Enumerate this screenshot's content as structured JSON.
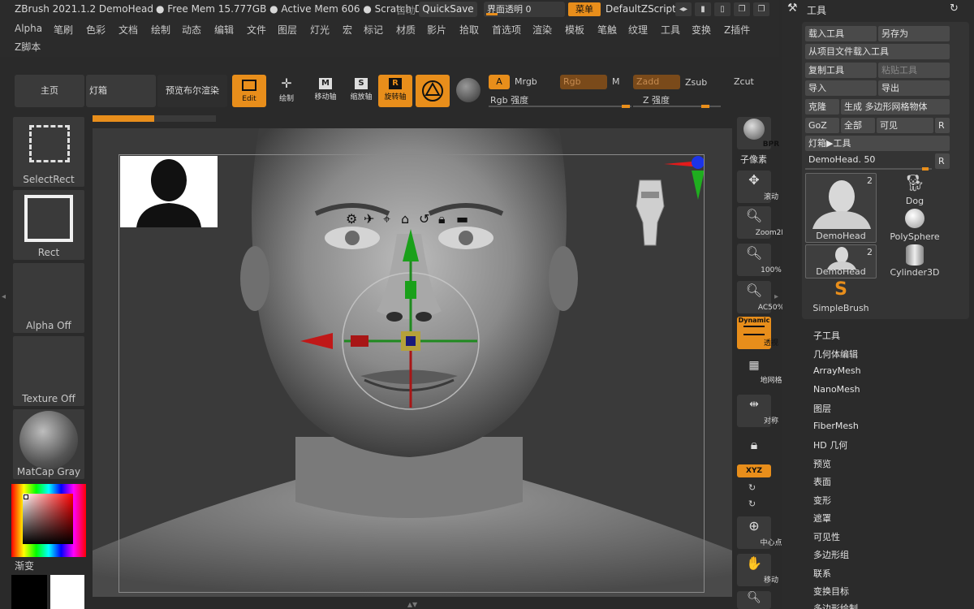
{
  "title_bar": {
    "app_info": "ZBrush 2021.1.2 DemoHead",
    "mem_info": "● Free Mem 15.777GB ● Active Mem 606 ● Scratch D",
    "auto_label": "自动",
    "quicksave": "QuickSave",
    "ui_transparency": "界面透明 0",
    "menu_button": "菜单",
    "default_zscript": "DefaultZScript"
  },
  "menu": {
    "row1": [
      "Alpha",
      "笔刷",
      "色彩",
      "文档",
      "绘制",
      "动态",
      "编辑",
      "文件",
      "图层",
      "灯光",
      "宏",
      "标记",
      "材质",
      "影片",
      "拾取",
      "首选项",
      "渲染",
      "模板",
      "笔触",
      "纹理",
      "工具",
      "变换",
      "Z插件"
    ],
    "row2": [
      "Z脚本"
    ]
  },
  "toolbar": {
    "home": "主页",
    "lightbox": "灯箱",
    "bpr_preview": "预览布尔渲染",
    "edit": "Edit",
    "draw": "绘制",
    "move": "移动轴",
    "scale": "缩放轴",
    "rotate": "旋转轴",
    "mode_a": "A",
    "mrgb": "Mrgb",
    "rgb": "Rgb",
    "m": "M",
    "zadd": "Zadd",
    "zsub": "Zsub",
    "zcut": "Zcut",
    "rgb_intensity": "Rgb 强度",
    "z_intensity": "Z 强度"
  },
  "left_shelf": {
    "select_rect": "SelectRect",
    "rect": "Rect",
    "alpha_off": "Alpha Off",
    "texture_off": "Texture Off",
    "matcap": "MatCap Gray",
    "gradient": "渐变"
  },
  "right_shelf": {
    "bpr": "BPR",
    "subpixel": "子像素",
    "scroll": "滚动",
    "zoom2d": "Zoom2D",
    "pct100": "100%",
    "ac50": "AC50%",
    "dynamic": "Dynamic",
    "perspective": "透视",
    "floor": "地网格",
    "symmetry": "对称",
    "xyz": "XYZ",
    "center": "中心点",
    "move": "移动"
  },
  "tool_panel": {
    "title": "工具",
    "load_tool": "载入工具",
    "save_as": "另存为",
    "load_from_project": "从项目文件载入工具",
    "copy_tool": "复制工具",
    "paste_tool": "粘贴工具",
    "import": "导入",
    "export": "导出",
    "clone": "克隆",
    "make_polymesh": "生成 多边形网格物体",
    "goz": "GoZ",
    "all": "全部",
    "visible": "可见",
    "r": "R",
    "lightbox_tools": "灯箱▶工具",
    "slider_label": "DemoHead. 50",
    "thumbs": [
      {
        "name": "DemoHead",
        "count": "2"
      },
      {
        "name": "Dog",
        "count": ""
      },
      {
        "name": "PolySphere",
        "count": ""
      },
      {
        "name": "DemoHead",
        "count": "2"
      },
      {
        "name": "Cylinder3D",
        "count": ""
      },
      {
        "name": "SimpleBrush",
        "count": ""
      }
    ],
    "subpalettes": [
      "子工具",
      "几何体编辑",
      "ArrayMesh",
      "NanoMesh",
      "图层",
      "FiberMesh",
      "HD 几何",
      "预览",
      "表面",
      "变形",
      "遮罩",
      "可见性",
      "多边形组",
      "联系",
      "变换目标",
      "多边形绘制"
    ]
  },
  "colors": {
    "accent": "#e88e1b",
    "panel": "#3a3a3a",
    "background": "#2b2b2b"
  }
}
